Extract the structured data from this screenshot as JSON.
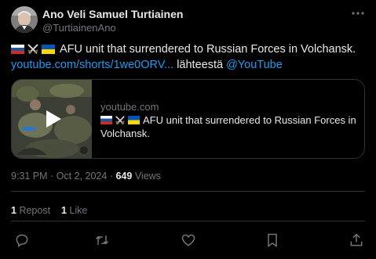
{
  "author": {
    "name": "Ano Veli Samuel Turtiainen",
    "handle": "@TurtiainenAno"
  },
  "tweet": {
    "text": "AFU unit that surrendered to Russian Forces in Volchansk.",
    "link_text": "youtube.com/shorts/1we0ORV...",
    "via_text": "lähteestä",
    "via_mention": "@YouTube",
    "flags": [
      "russia-flag-icon",
      "crossed-swords-icon",
      "ukraine-flag-icon"
    ]
  },
  "card": {
    "domain": "youtube.com",
    "title": "AFU unit that surrendered to Russian Forces in Volchansk."
  },
  "meta": {
    "time": "9:31 PM",
    "separator": "·",
    "date": "Oct 2, 2024",
    "views_count": "649",
    "views_label": "Views"
  },
  "stats": {
    "reposts_count": "1",
    "reposts_label": "Repost",
    "likes_count": "1",
    "likes_label": "Like"
  },
  "actions": [
    "reply-icon",
    "retweet-icon",
    "like-icon",
    "bookmark-icon",
    "share-icon"
  ],
  "colors": {
    "background": "#000000",
    "text": "#e7e9ea",
    "muted": "#71767b",
    "link": "#1d9bf0",
    "border": "#2f3336"
  }
}
